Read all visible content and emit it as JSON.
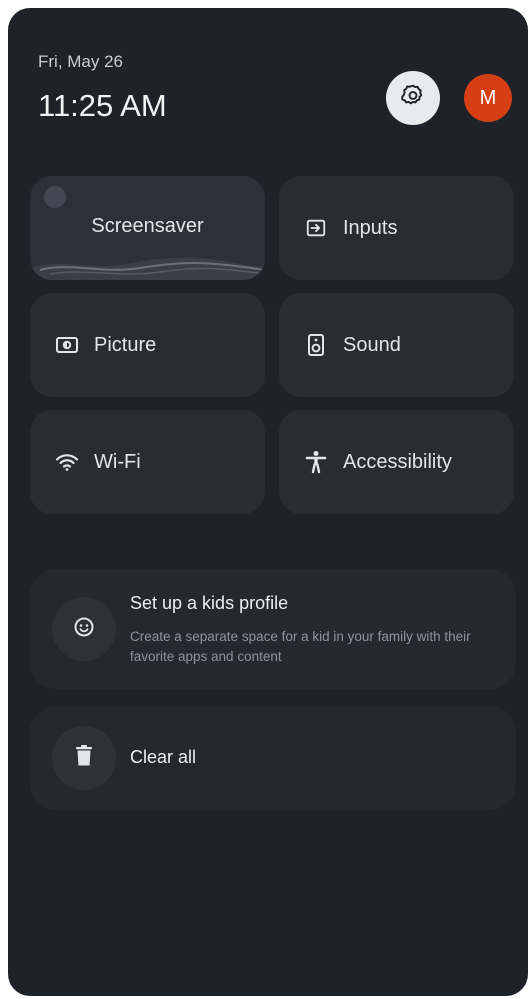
{
  "header": {
    "date": "Fri, May 26",
    "time": "11:25 AM",
    "avatar_letter": "M"
  },
  "tiles": [
    {
      "label": "Screensaver",
      "icon": "screensaver-preview"
    },
    {
      "label": "Inputs",
      "icon": "input-icon"
    },
    {
      "label": "Picture",
      "icon": "picture-icon"
    },
    {
      "label": "Sound",
      "icon": "speaker-icon"
    },
    {
      "label": "Wi-Fi",
      "icon": "wifi-icon"
    },
    {
      "label": "Accessibility",
      "icon": "accessibility-icon"
    }
  ],
  "kids_profile": {
    "title": "Set up a kids profile",
    "description": "Create a separate space for a kid in your family with their favorite apps and content",
    "icon": "kids-face-icon"
  },
  "clear_all": {
    "label": "Clear all",
    "icon": "trash-icon"
  },
  "colors": {
    "panel_bg": "#1f2228",
    "tile_bg": "#292c33",
    "avatar_bg": "#d63f13",
    "settings_bg": "#e8eaed"
  }
}
